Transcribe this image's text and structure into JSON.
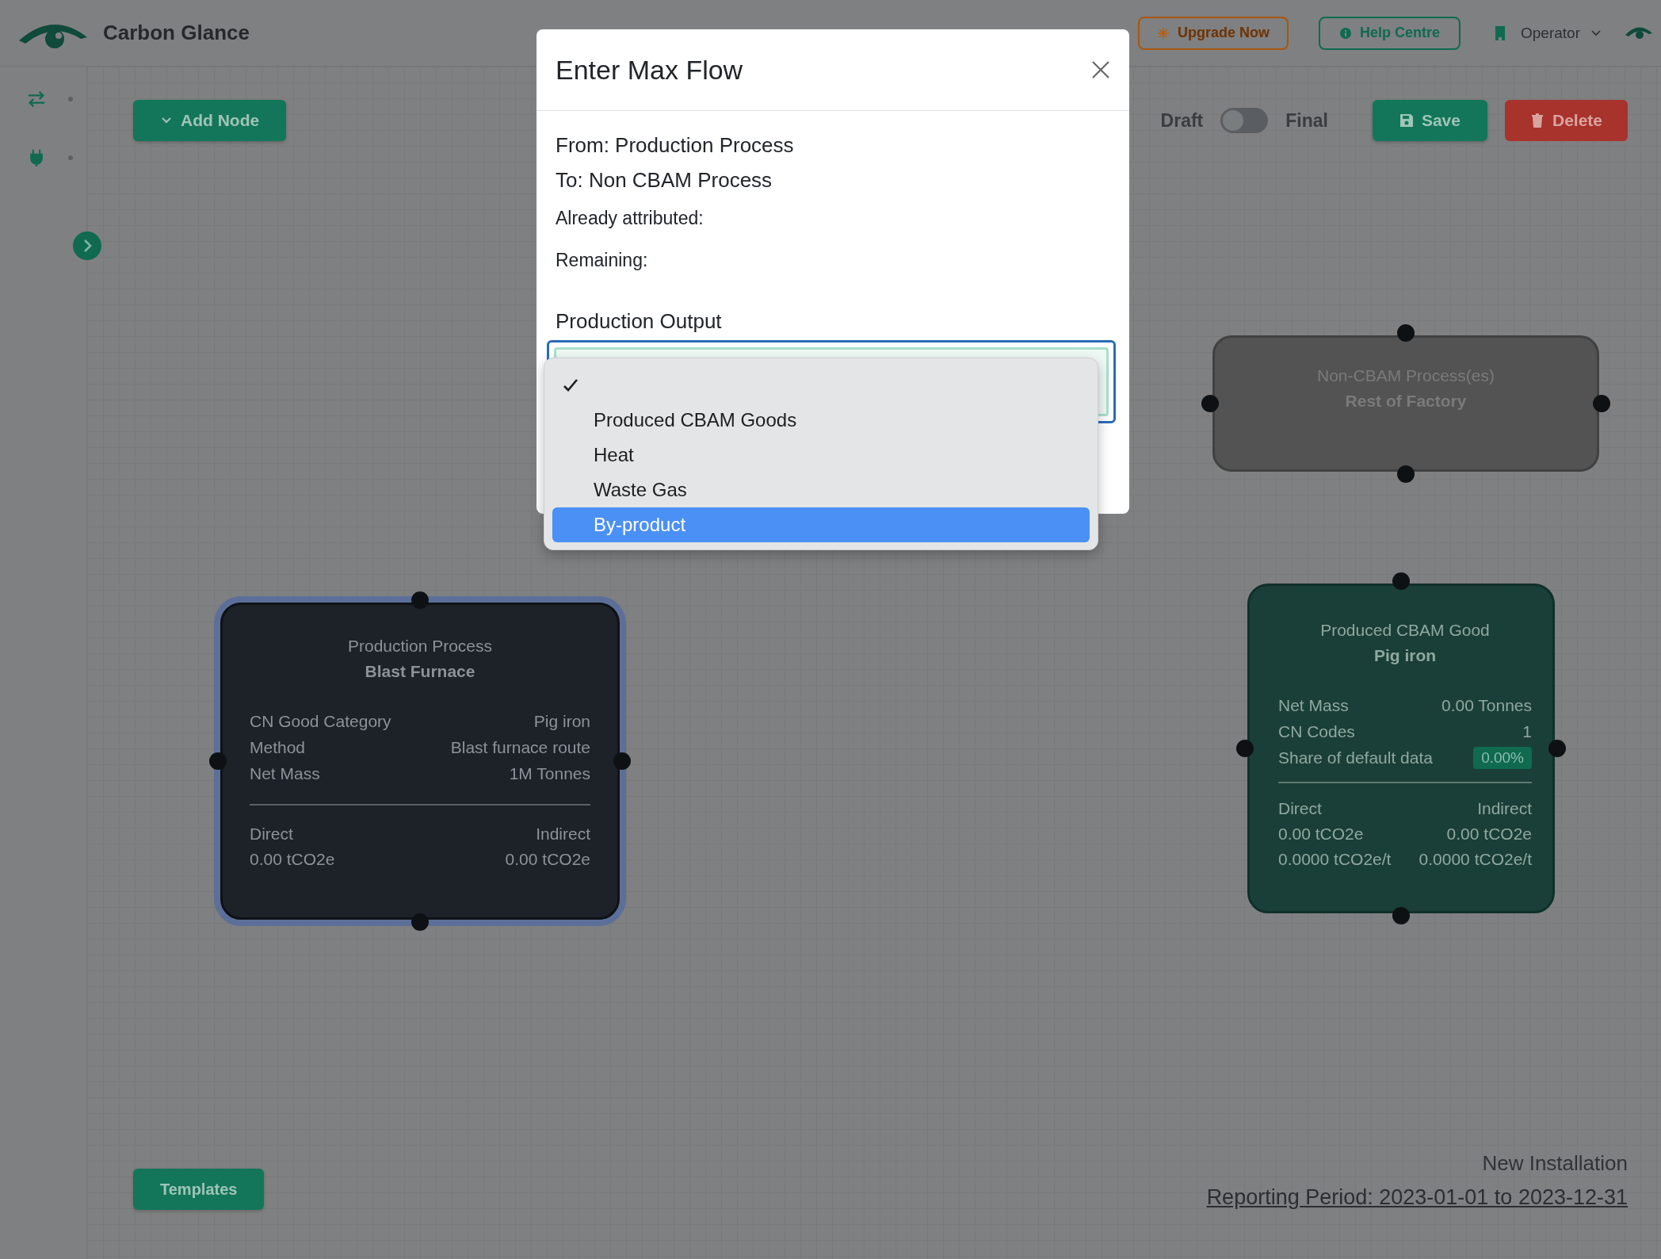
{
  "header": {
    "brand": "Carbon Glance",
    "upgrade_button": "Upgrade Now",
    "help_button": "Help Centre",
    "user": "Operator"
  },
  "toolbar": {
    "add_node": "Add Node",
    "draft_label": "Draft",
    "final_label": "Final",
    "final": false,
    "save": "Save",
    "delete": "Delete"
  },
  "canvas": {
    "nodes": [
      {
        "kind": "process",
        "selected": true,
        "title": "Production Process",
        "name": "Blast Furnace",
        "fields": [
          {
            "label": "CN Good Category",
            "value": "Pig iron",
            "badge": false
          },
          {
            "label": "Method",
            "value": "Blast furnace route",
            "badge": false
          },
          {
            "label": "Net Mass",
            "value": "1M Tonnes",
            "badge": false
          }
        ],
        "emissions": [
          {
            "label": "Direct",
            "values": [
              "0.00 tCO2e"
            ]
          },
          {
            "label": "Indirect",
            "values": [
              "0.00 tCO2e"
            ]
          }
        ]
      },
      {
        "kind": "non_cbam",
        "selected": false,
        "title": "Non-CBAM Process(es)",
        "name": "Rest of Factory"
      },
      {
        "kind": "good",
        "selected": false,
        "title": "Produced CBAM Good",
        "name": "Pig iron",
        "fields": [
          {
            "label": "Net Mass",
            "value": "0.00 Tonnes",
            "badge": false
          },
          {
            "label": "CN Codes",
            "value": "1",
            "badge": false
          },
          {
            "label": "Share of default data",
            "value": "0.00%",
            "badge": true
          }
        ],
        "emissions": [
          {
            "label": "Direct",
            "values": [
              "0.00 tCO2e",
              "0.0000 tCO2e/t"
            ]
          },
          {
            "label": "Indirect",
            "values": [
              "0.00 tCO2e",
              "0.0000 tCO2e/t"
            ]
          }
        ]
      }
    ]
  },
  "templates_button": "Templates",
  "footer": {
    "installation": "New Installation",
    "reporting_period": "Reporting Period: 2023-01-01 to 2023-12-31"
  },
  "modal": {
    "title": "Enter Max Flow",
    "lines": [
      {
        "kind": "heading",
        "text": "From: Production Process"
      },
      {
        "kind": "heading",
        "text": "To: Non CBAM Process"
      },
      {
        "kind": "plain",
        "text": "Already attributed:"
      },
      {
        "kind": "plain",
        "text": "Remaining:"
      }
    ],
    "field_label": "Production Output",
    "options": [
      {
        "checked": true,
        "selected": false
      },
      {
        "label": "Produced CBAM Goods",
        "checked": false,
        "selected": false
      },
      {
        "label": "Heat",
        "checked": false,
        "selected": false
      },
      {
        "label": "Waste Gas",
        "checked": false,
        "selected": false
      },
      {
        "label": "By-product",
        "checked": false,
        "selected": true
      }
    ]
  }
}
